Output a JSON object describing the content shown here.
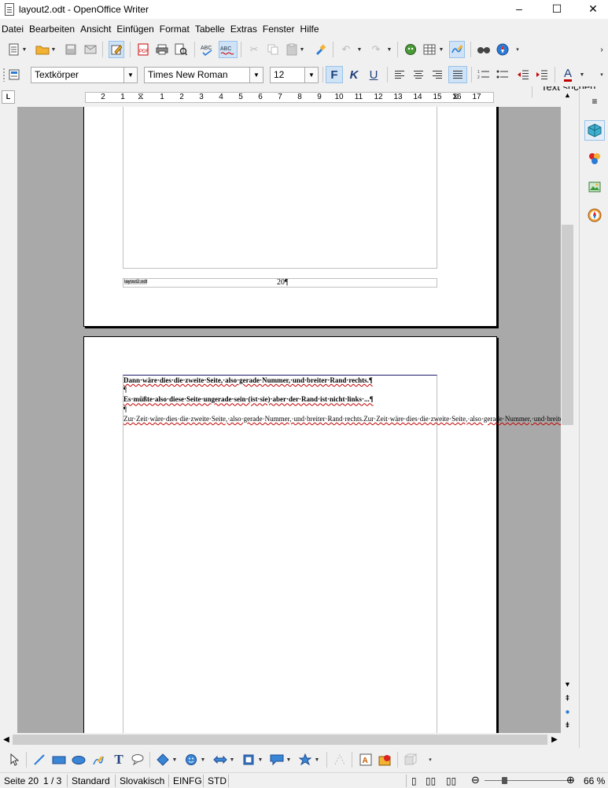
{
  "window": {
    "title": "layout2.odt - OpenOffice Writer",
    "minimize_glyph": "–",
    "maximize_glyph": "☐",
    "close_glyph": "✕"
  },
  "menu": [
    "Datei",
    "Bearbeiten",
    "Ansicht",
    "Einfügen",
    "Format",
    "Tabelle",
    "Extras",
    "Fenster",
    "Hilfe"
  ],
  "toolbar_standard": {
    "find_label": "Text suchen"
  },
  "toolbar_formatting": {
    "paragraph_style": "Textkörper",
    "font_name": "Times New Roman",
    "font_size": "12",
    "bold_label": "F",
    "italic_label": "K",
    "underline_label": "U",
    "font_color_label": "A"
  },
  "ruler": {
    "tab_selector": "L",
    "labels": [
      "2",
      "1",
      "1",
      "2",
      "3",
      "4",
      "5",
      "6",
      "7",
      "8",
      "9",
      "10",
      "11",
      "12",
      "13",
      "14",
      "15",
      "16",
      "17"
    ]
  },
  "document": {
    "page_footer_left": "layout2.odt",
    "page_footer_page_number": "20¶",
    "para1": "Dann·wäre·dies·die·zweite·Seite,·also·gerade·Nummer,·und·breiter·Rand·rechts.¶",
    "pilcrow1": "¶",
    "para2": "Es·müßte·also·diese·Seite·ungerade·sein·(ist·sie)·aber·der·Rand·ist·nicht·links·...¶",
    "pilcrow2": "¶",
    "para3": "Zur·Zeit·wäre·dies·die·zweite·Seite,·also·gerade·Nummer,·und·breiter·Rand·rechts.Zur·Zeit·wäre·dies·die·zweite·Seite,·also·gerade·Nummer,·und·breiter·Rand·rechts.Zur·Zeit·wäre·dies·die·zweite·Seite,·also·gerade·Nummer,·und·breiter·Rand·rechts.Zur·Zeit·wäre·dies·die·zweite·Seite,·also·gerade·Nummer,·und·breiter·Rand·rechts.Zur·Zeit·wäre·dies·die·zweite·Seite,·also·gerade·Nummer,·und·breiter·Rand·rechts.Zur·Zeit·wäre·dies·die·zweite·Seite,·also·gerade·Nummer,·und·breiter·Rand·rechts.Zur·Zeit·wäre·dies·die·zweite·Seite,·also·gerade·Nummer,·und·breiter·Rand·rechts.¶"
  },
  "statusbar": {
    "page": "Seite 20",
    "page_count": "1 / 3",
    "page_style": "Standard",
    "language": "Slovakisch",
    "insert_mode": "EINFG",
    "selection_mode": "STD",
    "zoom": "66 %"
  },
  "colors": {
    "page_background": "#a9a9a9",
    "spell_underline": "#c00000",
    "accent_active": "#cfe3f7"
  }
}
